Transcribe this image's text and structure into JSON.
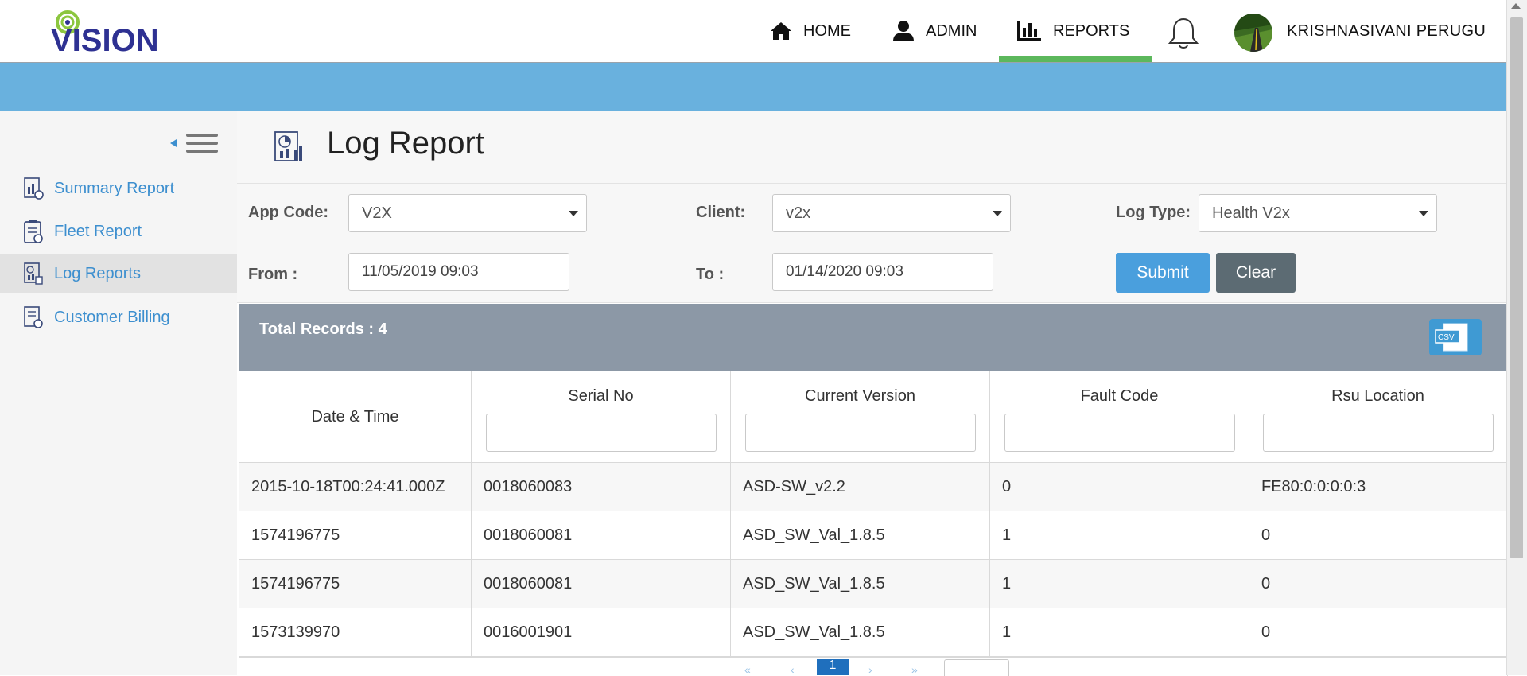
{
  "header": {
    "logo_text": "VISION",
    "nav": [
      {
        "label": "HOME",
        "icon": "home-icon"
      },
      {
        "label": "ADMIN",
        "icon": "user-icon"
      },
      {
        "label": "REPORTS",
        "icon": "bar-chart-icon",
        "active": true
      }
    ],
    "username": "KRISHNASIVANI PERUGU"
  },
  "sidebar": {
    "items": [
      {
        "label": "Summary Report",
        "icon": "summary-report-icon"
      },
      {
        "label": "Fleet Report",
        "icon": "clipboard-icon"
      },
      {
        "label": "Log Reports",
        "icon": "log-report-icon",
        "active": true
      },
      {
        "label": "Customer Billing",
        "icon": "billing-icon"
      }
    ]
  },
  "page": {
    "title": "Log Report"
  },
  "filters": {
    "app_code_label": "App Code:",
    "app_code_value": "V2X",
    "client_label": "Client:",
    "client_value": "v2x",
    "log_type_label": "Log Type:",
    "log_type_value": "Health V2x",
    "from_label": "From :",
    "from_value": "11/05/2019 09:03",
    "to_label": "To :",
    "to_value": "01/14/2020 09:03",
    "submit_label": "Submit",
    "clear_label": "Clear"
  },
  "records": {
    "total_label": "Total Records : 4",
    "export_label": "CSV"
  },
  "table": {
    "columns": [
      "Date & Time",
      "Serial No",
      "Current Version",
      "Fault Code",
      "Rsu Location"
    ],
    "rows": [
      [
        "2015-10-18T00:24:41.000Z",
        "0018060083",
        "ASD-SW_v2.2",
        "0",
        "FE80:0:0:0:0:3"
      ],
      [
        "1574196775",
        "0018060081",
        "ASD_SW_Val_1.8.5",
        "1",
        "0"
      ],
      [
        "1574196775",
        "0018060081",
        "ASD_SW_Val_1.8.5",
        "1",
        "0"
      ],
      [
        "1573139970",
        "0016001901",
        "ASD_SW_Val_1.8.5",
        "1",
        "0"
      ]
    ]
  },
  "pagination": {
    "current_page": "1"
  },
  "colors": {
    "accent": "#69b1de",
    "active_tab": "#5cb85c",
    "link": "#3d8fcf",
    "records_bar": "#8c98a6"
  }
}
